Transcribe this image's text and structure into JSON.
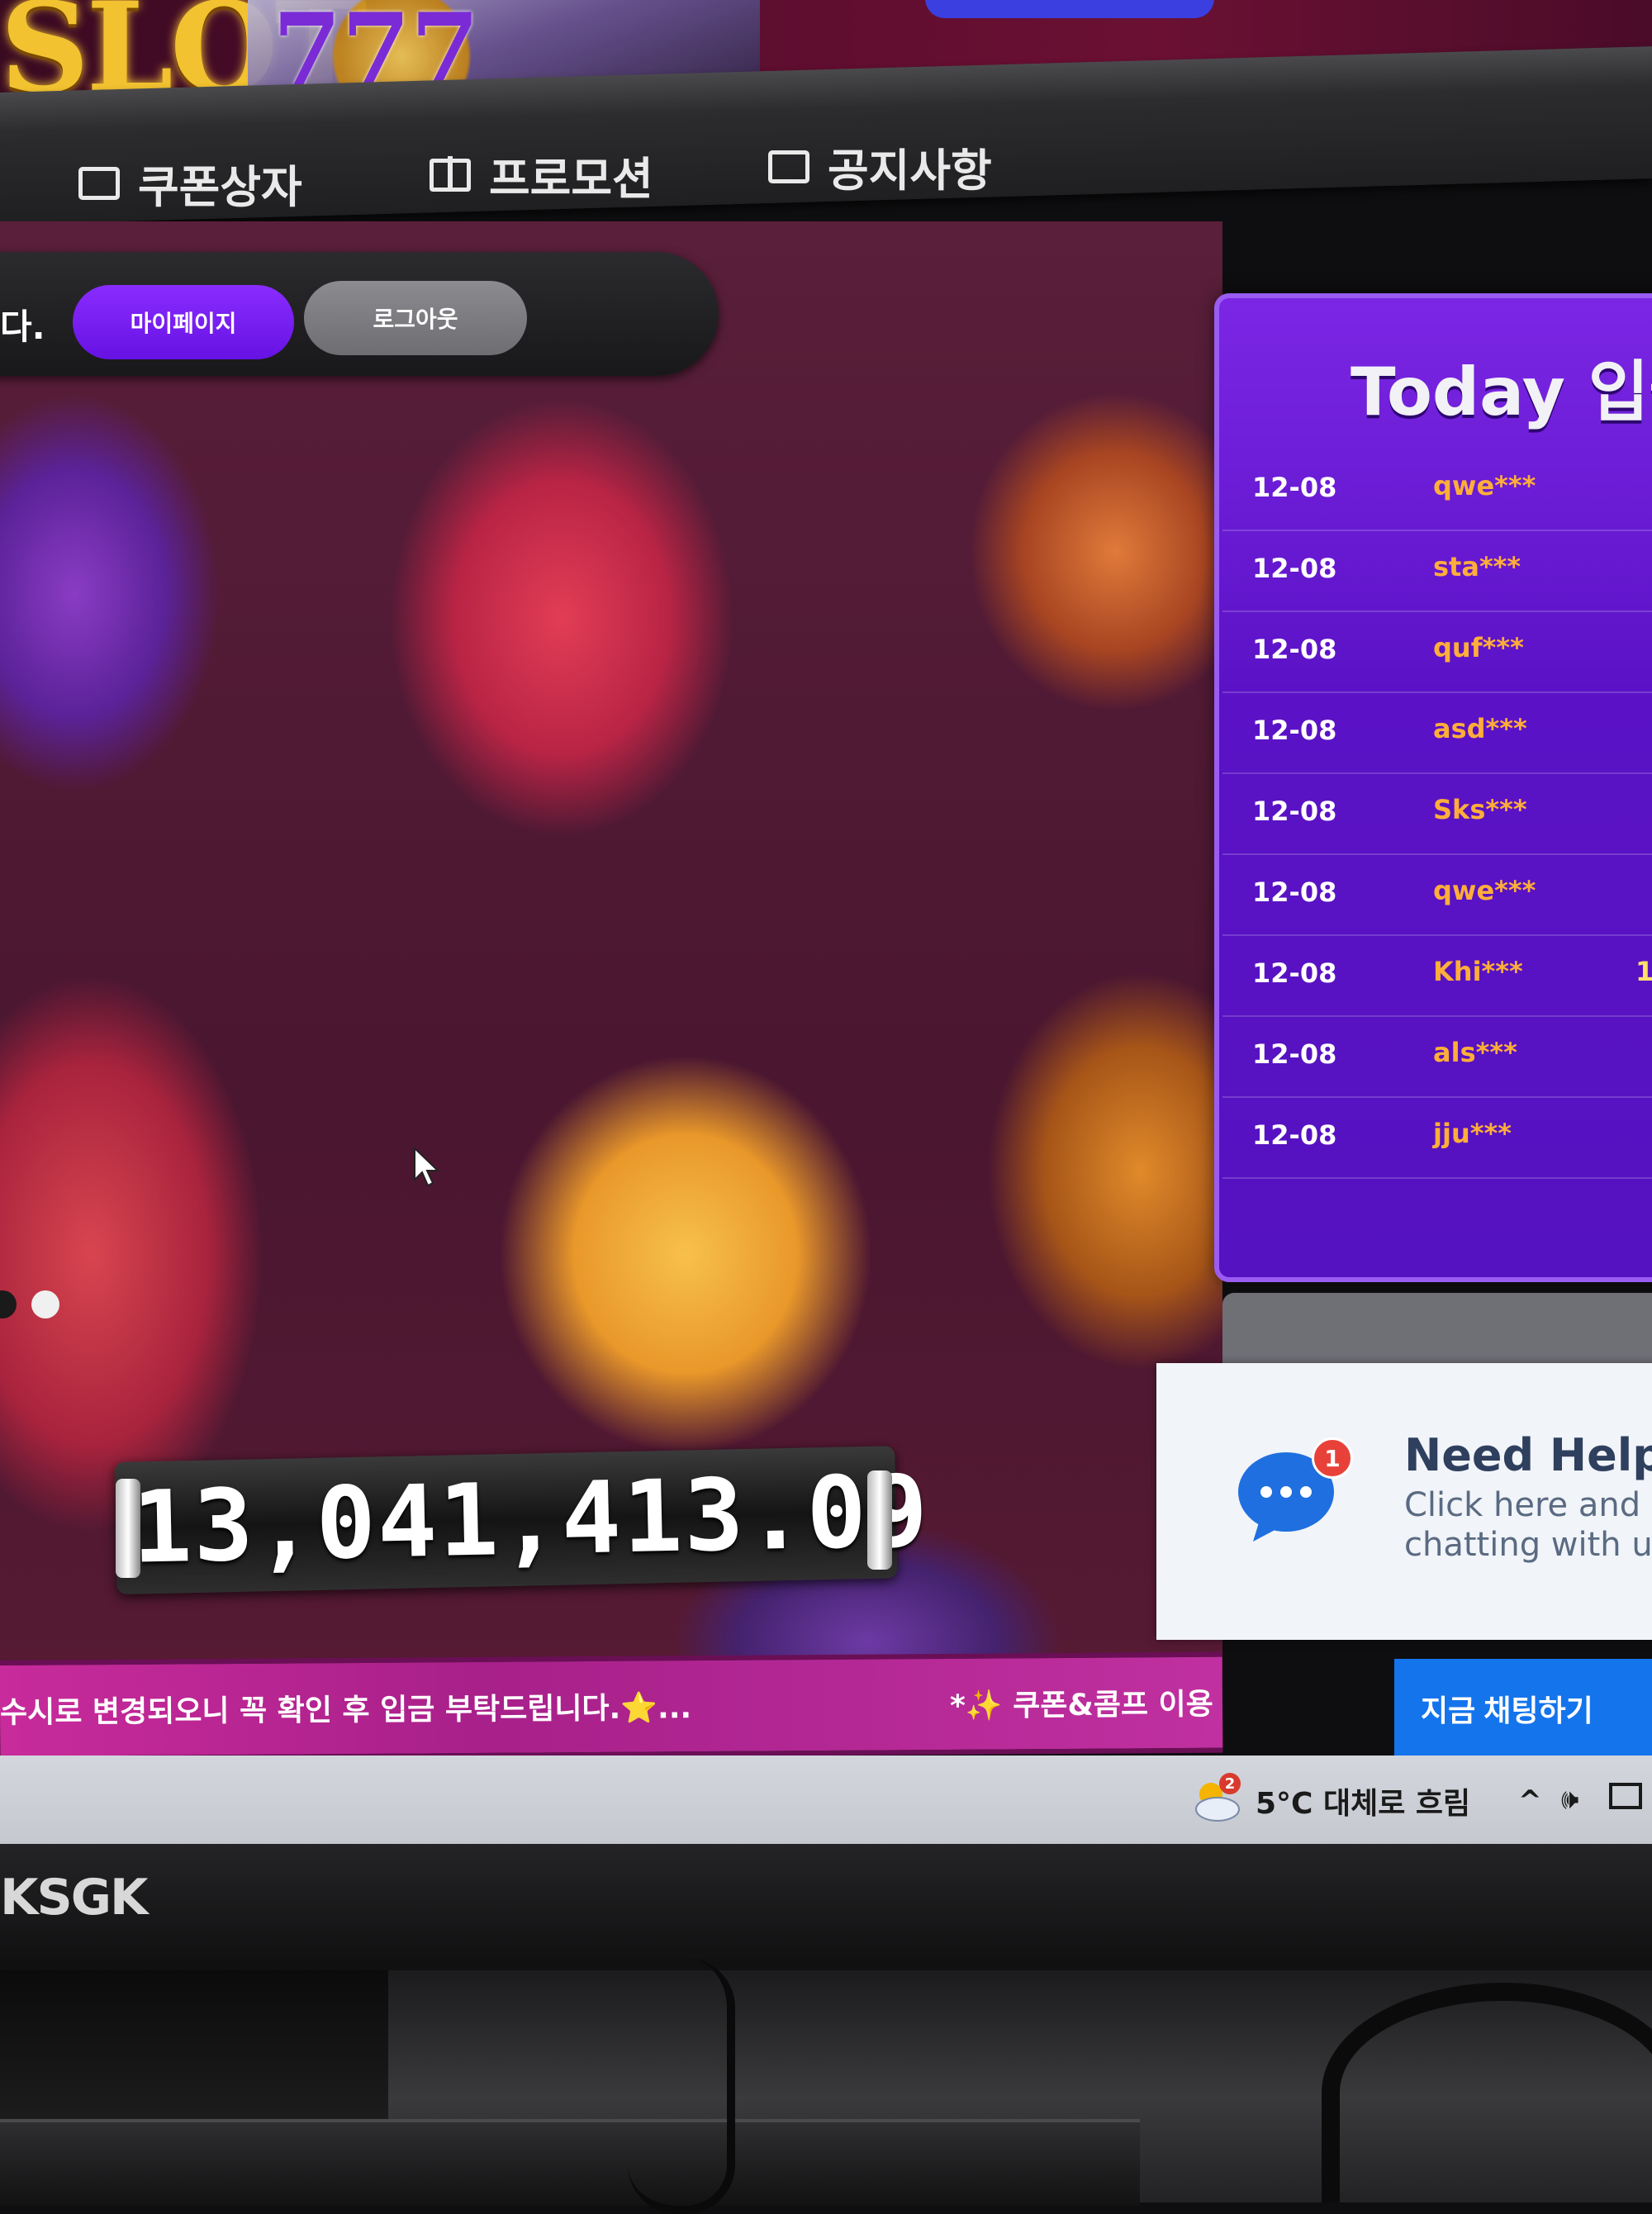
{
  "header": {
    "logo_text": "SLOT",
    "slot_digits": "777"
  },
  "nav": {
    "items": [
      {
        "label": "쿠폰상자",
        "icon": "coupon-box-icon"
      },
      {
        "label": "프로모션",
        "icon": "gift-icon"
      },
      {
        "label": "공지사항",
        "icon": "notice-icon"
      }
    ]
  },
  "user_bar": {
    "welcome_tail": "다.",
    "mypage_label": "마이페이지",
    "logout_label": "로그아웃"
  },
  "jackpot": {
    "value": "13,041,413.09"
  },
  "marquee": {
    "left_text": "수시로 변경되오니 꼭 확인 후 입금 부탁드립니다.⭐...",
    "right_text": "*✨ 쿠폰&콤프 이용"
  },
  "deposit_panel": {
    "title": "Today 입금",
    "rows": [
      {
        "date": "12-08",
        "user": "qwe***",
        "amount": ""
      },
      {
        "date": "12-08",
        "user": "sta***",
        "amount": ""
      },
      {
        "date": "12-08",
        "user": "quf***",
        "amount": ""
      },
      {
        "date": "12-08",
        "user": "asd***",
        "amount": ""
      },
      {
        "date": "12-08",
        "user": "Sks***",
        "amount": ""
      },
      {
        "date": "12-08",
        "user": "qwe***",
        "amount": ""
      },
      {
        "date": "12-08",
        "user": "Khi***",
        "amount": "1"
      },
      {
        "date": "12-08",
        "user": "als***",
        "amount": ""
      },
      {
        "date": "12-08",
        "user": "jju***",
        "amount": ""
      }
    ]
  },
  "help_widget": {
    "badge_count": "1",
    "title": "Need Help?",
    "subtitle": "Click here and s chatting with us",
    "chat_button": "지금 채팅하기"
  },
  "taskbar": {
    "weather_badge": "2",
    "weather_text": "5°C 대체로 흐림",
    "tray_chevron": "^",
    "tray_volume": "🕪"
  },
  "monitor": {
    "brand": "KSGK"
  },
  "colors": {
    "primary_purple": "#7b26e4",
    "mypage_button": "#6612e3",
    "marquee_pink": "#c82b9b",
    "chat_blue": "#1474ec",
    "username_orange": "#ffae3a"
  }
}
